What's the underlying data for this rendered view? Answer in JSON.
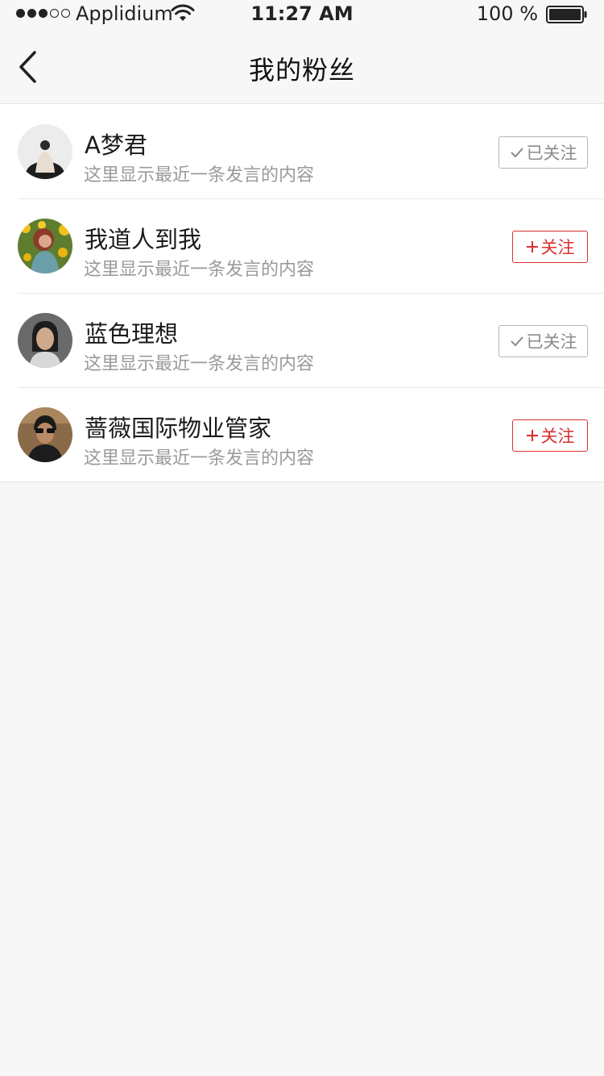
{
  "status_bar": {
    "carrier": "Applidium",
    "time": "11:27 AM",
    "battery": "100 %",
    "signal_bars_filled": 3,
    "signal_bars_total": 5
  },
  "nav": {
    "title": "我的粉丝",
    "back_icon": "chevron-left-icon"
  },
  "colors": {
    "accent_red": "#d9302f",
    "followed_gray": "#8a8a8a",
    "background": "#f7f7f7"
  },
  "fans": [
    {
      "name": "A梦君",
      "desc": "这里显示最近一条发言的内容",
      "status": "followed",
      "button_label": "已关注",
      "button_icon": "check-icon"
    },
    {
      "name": "我道人到我",
      "desc": "这里显示最近一条发言的内容",
      "status": "unfollowed",
      "button_label": "关注",
      "button_icon": "plus-icon"
    },
    {
      "name": "蓝色理想",
      "desc": "这里显示最近一条发言的内容",
      "status": "followed",
      "button_label": "已关注",
      "button_icon": "check-icon"
    },
    {
      "name": "蔷薇国际物业管家",
      "desc": "这里显示最近一条发言的内容",
      "status": "unfollowed",
      "button_label": "关注",
      "button_icon": "plus-icon"
    }
  ]
}
